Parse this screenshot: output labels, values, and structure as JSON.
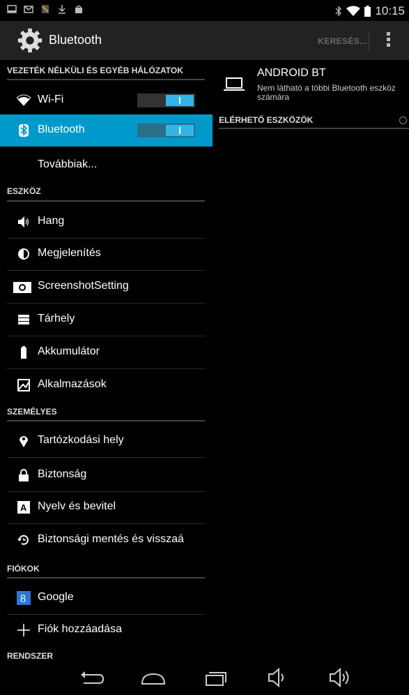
{
  "status_bar": {
    "icons": [
      "notification-icon",
      "mail-icon",
      "app-icon",
      "download-icon",
      "bag-icon"
    ],
    "right_icons": [
      "bluetooth-icon",
      "wifi-icon",
      "battery-icon"
    ],
    "time": "10:15"
  },
  "action_bar": {
    "title": "Bluetooth",
    "search_label": "KERESÉS...",
    "overflow_icon": "overflow-menu-icon"
  },
  "sections": {
    "wireless": "VEZETÉK NÉLKÜLI ÉS EGYÉB HÁLÓZATOK",
    "device": "ESZKÖZ",
    "personal": "SZEMÉLYES",
    "accounts": "FIÓKOK",
    "system": "RENDSZER"
  },
  "items": {
    "wifi": "Wi-Fi",
    "bluetooth": "Bluetooth",
    "more": "Továbbiak...",
    "sound": "Hang",
    "display": "Megjelenítés",
    "screenshot": "ScreenshotSetting",
    "storage": "Tárhely",
    "battery": "Akkumulátor",
    "apps": "Alkalmazások",
    "location": "Tartózkodási hely",
    "security": "Biztonság",
    "language": "Nyelv és bevitel",
    "backup": "Biztonsági mentés és visszaá",
    "google": "Google",
    "add_account": "Fiók hozzáadása"
  },
  "toggles": {
    "wifi": "on",
    "bluetooth": "on"
  },
  "bluetooth_pane": {
    "device_name": "ANDROID BT",
    "device_status": "Nem látható a többi Bluetooth eszköz számára",
    "available_header": "ELÉRHETŐ ESZKÖZÖK"
  },
  "nav_bar": {
    "buttons": [
      "back-icon",
      "home-icon",
      "recents-icon",
      "volume-down-icon",
      "volume-up-icon"
    ]
  },
  "colors": {
    "accent": "#0099cc",
    "switch_on": "#33b5e5",
    "action_bar": "#222222",
    "background": "#000000"
  }
}
